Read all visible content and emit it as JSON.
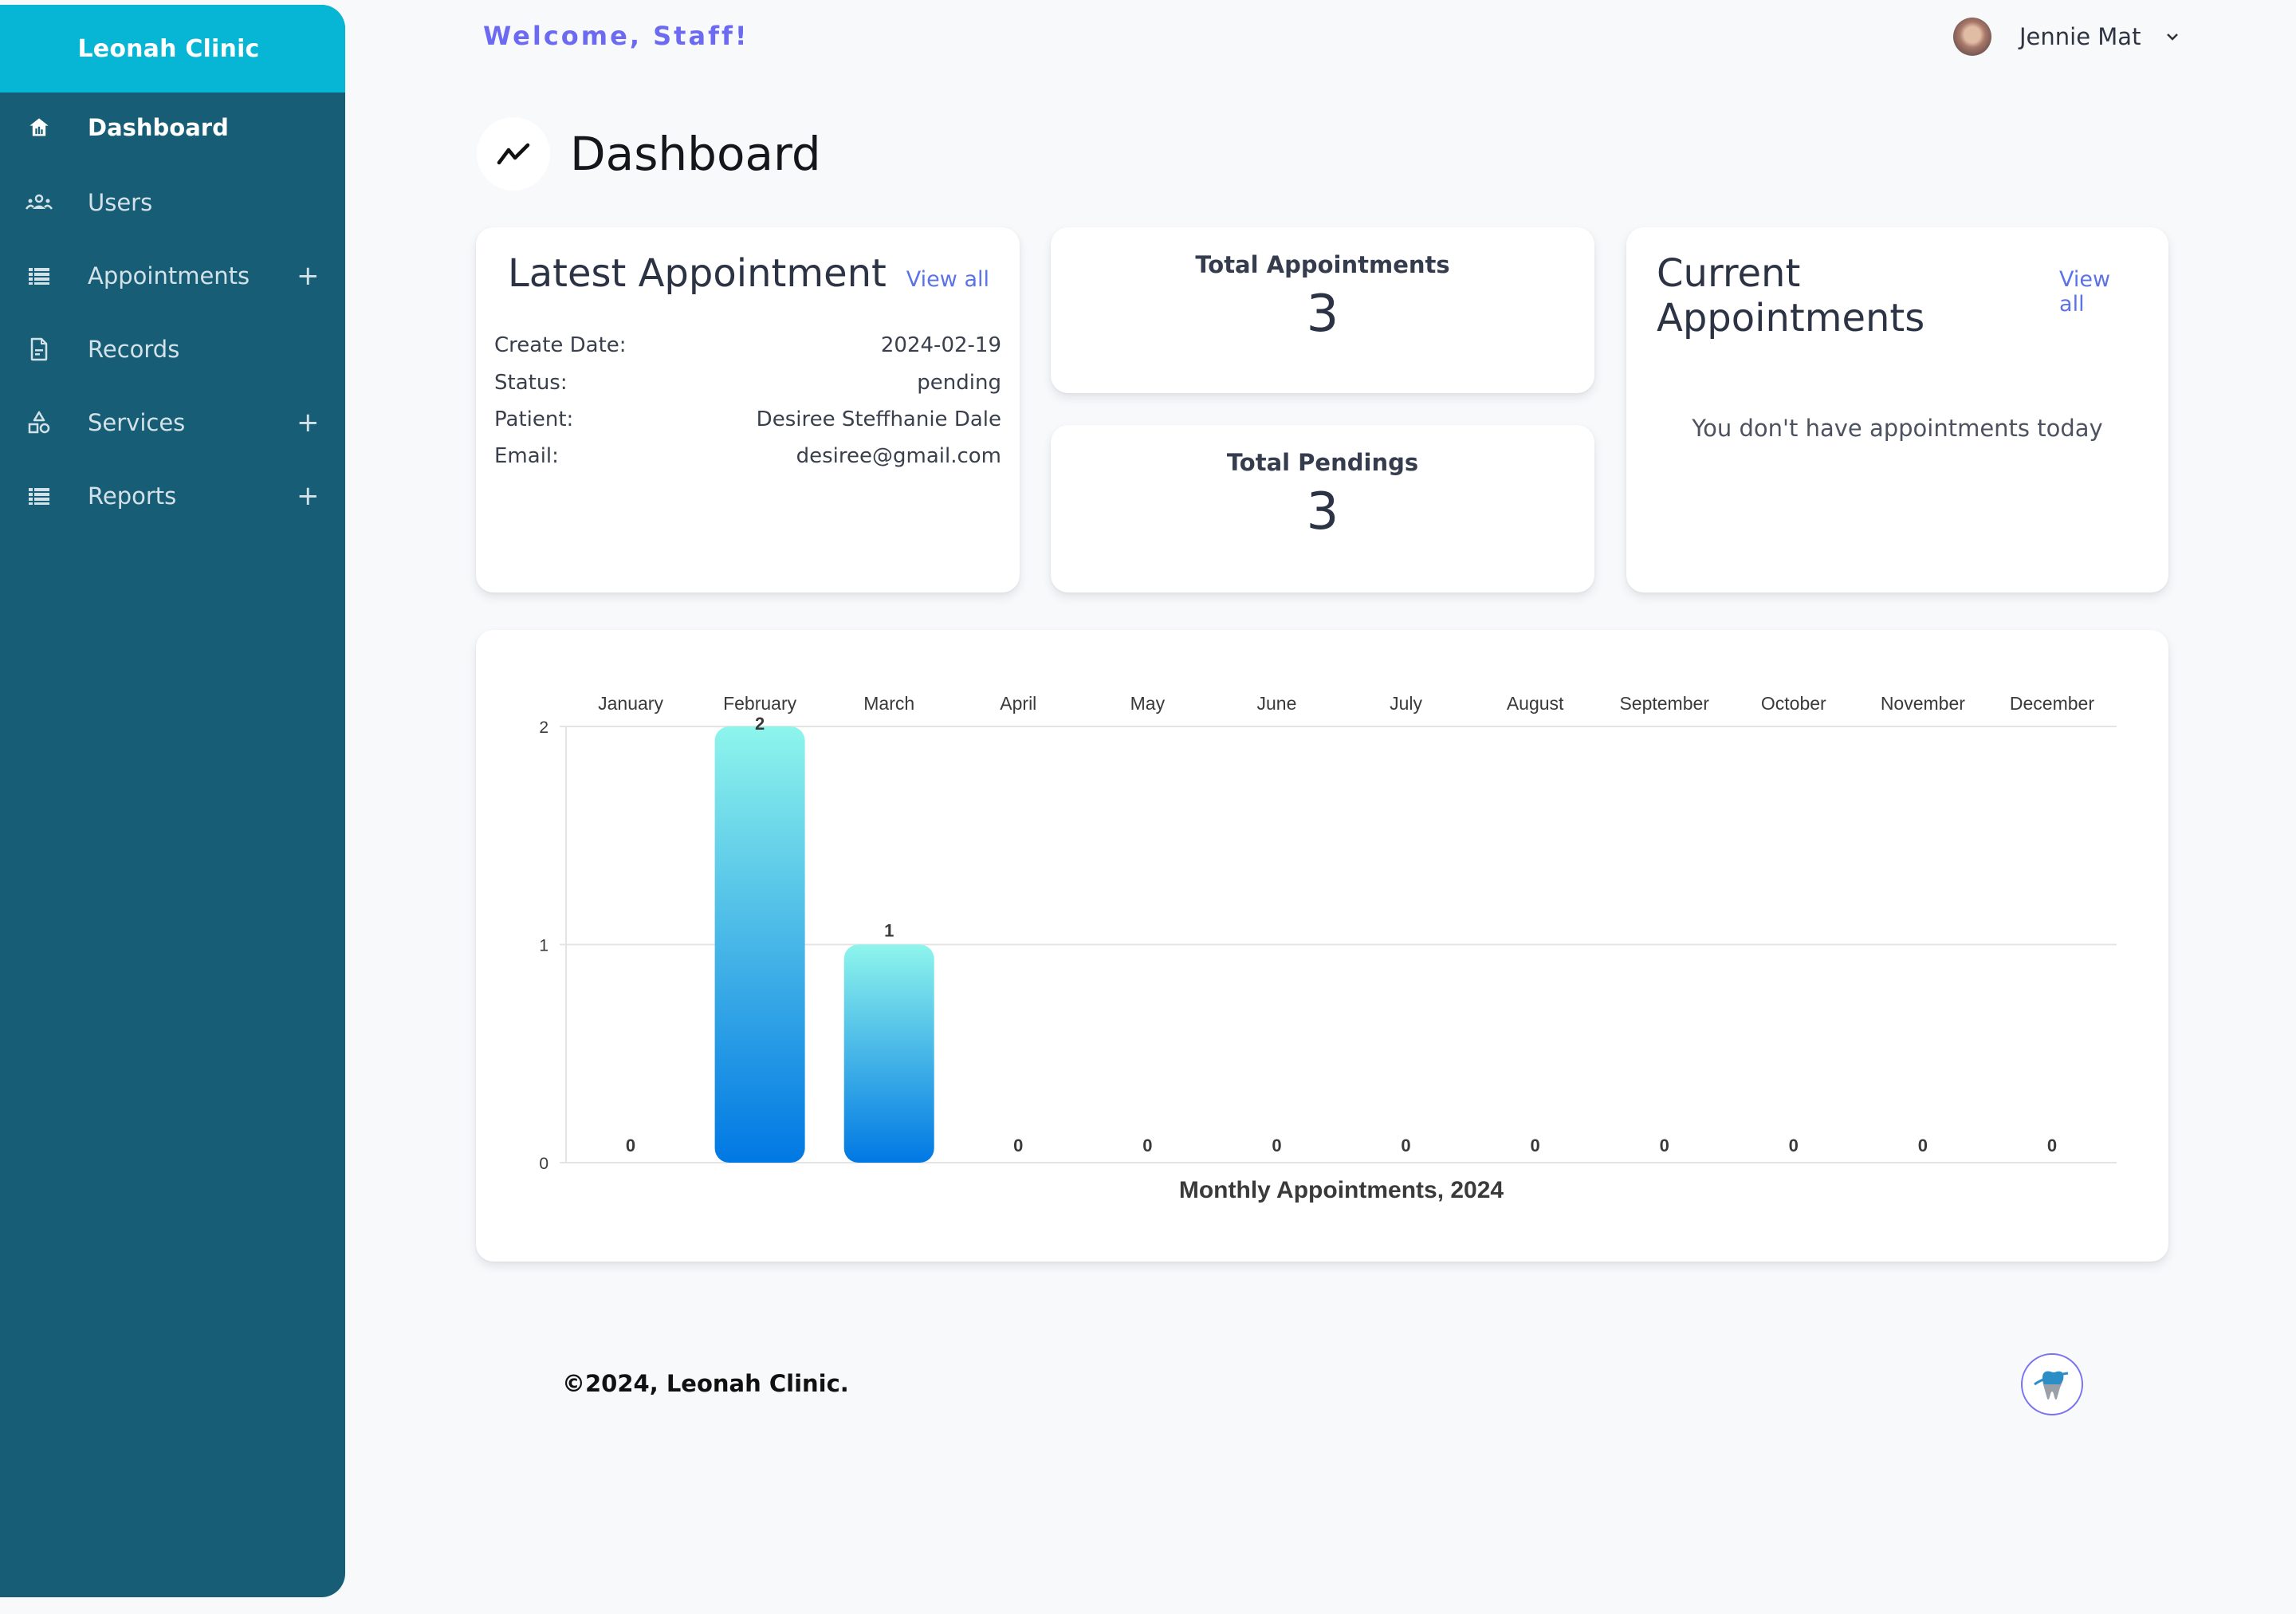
{
  "sidebar": {
    "brand": "Leonah Clinic",
    "items": [
      {
        "label": "Dashboard",
        "icon": "home-icon",
        "active": true,
        "expandable": false
      },
      {
        "label": "Users",
        "icon": "users-icon",
        "active": false,
        "expandable": false
      },
      {
        "label": "Appointments",
        "icon": "list-icon",
        "active": false,
        "expandable": true
      },
      {
        "label": "Records",
        "icon": "document-icon",
        "active": false,
        "expandable": false
      },
      {
        "label": "Services",
        "icon": "shapes-icon",
        "active": false,
        "expandable": true
      },
      {
        "label": "Reports",
        "icon": "list-icon",
        "active": false,
        "expandable": true
      }
    ],
    "expand_symbol": "+"
  },
  "header": {
    "welcome": "Welcome, Staff!",
    "user_name": "Jennie Mat"
  },
  "page": {
    "title": "Dashboard"
  },
  "latest_appointment": {
    "title": "Latest Appointment",
    "view_all": "View all",
    "fields": [
      {
        "label": "Create Date:",
        "value": "2024-02-19"
      },
      {
        "label": "Status:",
        "value": "pending"
      },
      {
        "label": "Patient:",
        "value": "Desiree Steffhanie Dale"
      },
      {
        "label": "Email:",
        "value": "desiree@gmail.com"
      }
    ]
  },
  "stats": {
    "total_appointments": {
      "label": "Total Appointments",
      "value": "3"
    },
    "total_pendings": {
      "label": "Total Pendings",
      "value": "3"
    }
  },
  "current_appointments": {
    "title": "Current Appointments",
    "view_all": "View all",
    "empty_message": "You don't have appointments today"
  },
  "chart_data": {
    "type": "bar",
    "title": "Monthly Appointments, 2024",
    "xlabel": "",
    "ylabel": "",
    "categories": [
      "January",
      "February",
      "March",
      "April",
      "May",
      "June",
      "July",
      "August",
      "September",
      "October",
      "November",
      "December"
    ],
    "values": [
      0,
      2,
      1,
      0,
      0,
      0,
      0,
      0,
      0,
      0,
      0,
      0
    ],
    "ylim": [
      0,
      2
    ],
    "yticks": [
      0,
      1,
      2
    ],
    "category_axis_position": "top",
    "grid": true,
    "data_labels": true,
    "bar_gradient": [
      "#8ef5ec",
      "#0078e3"
    ]
  },
  "footer": {
    "copyright": "©2024, Leonah Clinic."
  },
  "colors": {
    "sidebar": "#175d75",
    "sidebar_header": "#07b6d5",
    "accent": "#6d6af2",
    "link": "#5b73e6",
    "background": "#f8f9fb"
  }
}
